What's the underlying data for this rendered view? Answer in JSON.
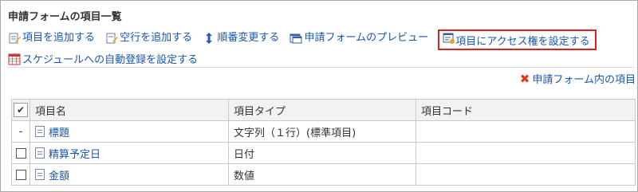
{
  "section_title": "申請フォームの項目一覧",
  "toolbar": {
    "add_item": "項目を追加する",
    "add_blank_row": "空行を追加する",
    "reorder": "順番変更する",
    "preview": "申請フォームのプレビュー",
    "set_access": "項目にアクセス権を設定する",
    "auto_schedule": "スケジュールへの自動登録を設定する"
  },
  "remove_items_link": "申請フォーム内の項目",
  "table": {
    "headers": {
      "check": "✔",
      "name": "項目名",
      "type": "項目タイプ",
      "code": "項目コード"
    },
    "rows": [
      {
        "check": "-",
        "name": "標題",
        "type": "文字列（１行）(標準項目)",
        "code": ""
      },
      {
        "check": "",
        "name": "精算予定日",
        "type": "日付",
        "code": ""
      },
      {
        "check": "",
        "name": "金額",
        "type": "数値",
        "code": ""
      }
    ]
  },
  "colors": {
    "link": "#1a56b0",
    "highlight_border": "#e0201a",
    "remove_icon": "#e03a1a"
  }
}
